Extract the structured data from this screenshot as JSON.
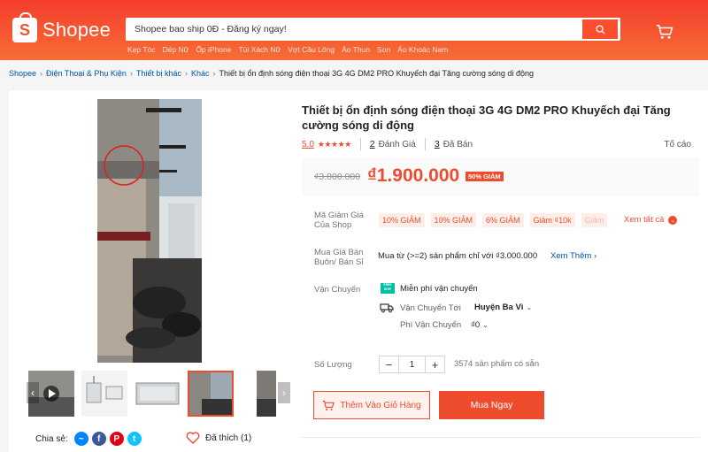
{
  "brand": {
    "name": "Shopee"
  },
  "search": {
    "placeholder": "Shopee bao ship 0Đ - Đăng ký ngay!",
    "suggestions": [
      "Kẹp Tóc",
      "Dép Nữ",
      "Ốp iPhone",
      "Túi Xách Nữ",
      "Vợt Cầu Lông",
      "Áo Thun",
      "Son",
      "Áo Khoác Nam"
    ]
  },
  "breadcrumb": {
    "items": [
      "Shopee",
      "Điện Thoại & Phụ Kiện",
      "Thiết bị khác",
      "Khác"
    ],
    "current": "Thiết bị ổn định sóng điện thoại 3G 4G DM2 PRO Khuyếch đại Tăng cường sóng di động"
  },
  "product": {
    "title": "Thiết bị ổn định sóng điện thoại 3G 4G DM2 PRO Khuyếch đại Tăng cường sóng di động",
    "rating": "5.0",
    "rating_value": 5,
    "reviews_count": "2",
    "reviews_label": "Đánh Giá",
    "sold_count": "3",
    "sold_label": "Đã Bán",
    "report_label": "Tố cáo",
    "old_price": "₫3.800.000",
    "price": "₫1.900.000",
    "discount_badge": "50% GIẢM"
  },
  "vouchers": {
    "label": "Mã Giảm Giá Của Shop",
    "items": [
      "10% GIẢM",
      "10% GIẢM",
      "6% GIẢM",
      "Giảm ₫10k",
      "Giảm"
    ],
    "see_all": "Xem tất cả"
  },
  "wholesale": {
    "label": "Mua Giá Bán Buôn/ Bán Sỉ",
    "text": "Mua từ (>=2) sản phẩm chỉ với ₫3.000.000",
    "see_more": "Xem Thêm"
  },
  "shipping": {
    "label": "Vận Chuyển",
    "free_text": "Miễn phí vận chuyển",
    "free_icon_text": "FREE SHIP",
    "to_label": "Vận Chuyển Tới",
    "to_value": "Huyện Ba Vì",
    "fee_label": "Phí Vận Chuyển",
    "fee_value": "₫0"
  },
  "quantity": {
    "label": "Số Lượng",
    "value": "1",
    "stock": "3574 sản phẩm có sẵn"
  },
  "actions": {
    "add_to_cart": "Thêm Vào Giỏ Hàng",
    "buy_now": "Mua Ngay"
  },
  "social": {
    "share_label": "Chia sẻ:",
    "liked_label": "Đã thích (1)"
  },
  "colors": {
    "accent": "#ee4d2d",
    "header_start": "#f53d2d",
    "header_end": "#f66d35",
    "link": "#0055aa"
  }
}
